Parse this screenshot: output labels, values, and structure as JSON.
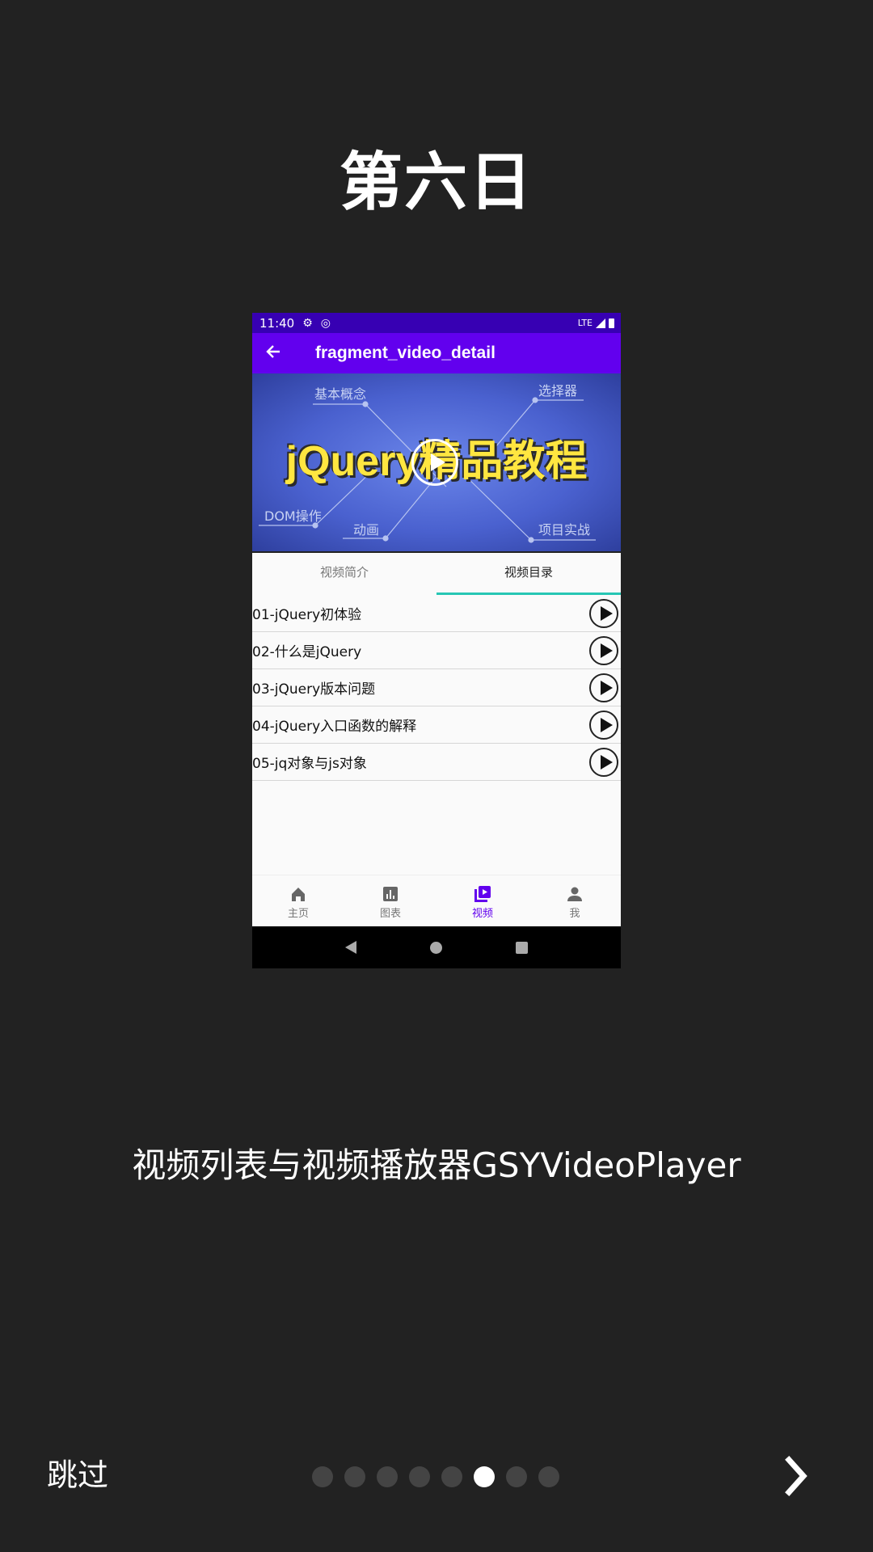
{
  "page": {
    "title": "第六日",
    "subtitle": "视频列表与视频播放器GSYVideoPlayer",
    "skip_label": "跳过",
    "next_icon": "chevron-right-icon",
    "pager": {
      "count": 8,
      "active_index": 5
    }
  },
  "phone": {
    "statusbar": {
      "time": "11:40",
      "network": "LTE"
    },
    "appbar": {
      "title": "fragment_video_detail",
      "back_icon": "arrow-back-icon"
    },
    "video": {
      "banner_text": "jQuery精品教程",
      "labels": [
        "基本概念",
        "选择器",
        "DOM操作",
        "动画",
        "项目实战"
      ]
    },
    "tabs": [
      {
        "label": "视频简介",
        "active": false
      },
      {
        "label": "视频目录",
        "active": true
      }
    ],
    "items": [
      "01-jQuery初体验",
      "02-什么是jQuery",
      "03-jQuery版本问题",
      "04-jQuery入口函数的解释",
      "05-jq对象与js对象"
    ],
    "bottom_nav": [
      {
        "label": "主页",
        "icon": "home-icon"
      },
      {
        "label": "图表",
        "icon": "chart-icon"
      },
      {
        "label": "视频",
        "icon": "video-library-icon",
        "active": true
      },
      {
        "label": "我",
        "icon": "person-icon"
      }
    ],
    "colors": {
      "primary": "#6200ee",
      "primary_dark": "#3700b3",
      "tab_indicator": "#26c6b4"
    }
  }
}
